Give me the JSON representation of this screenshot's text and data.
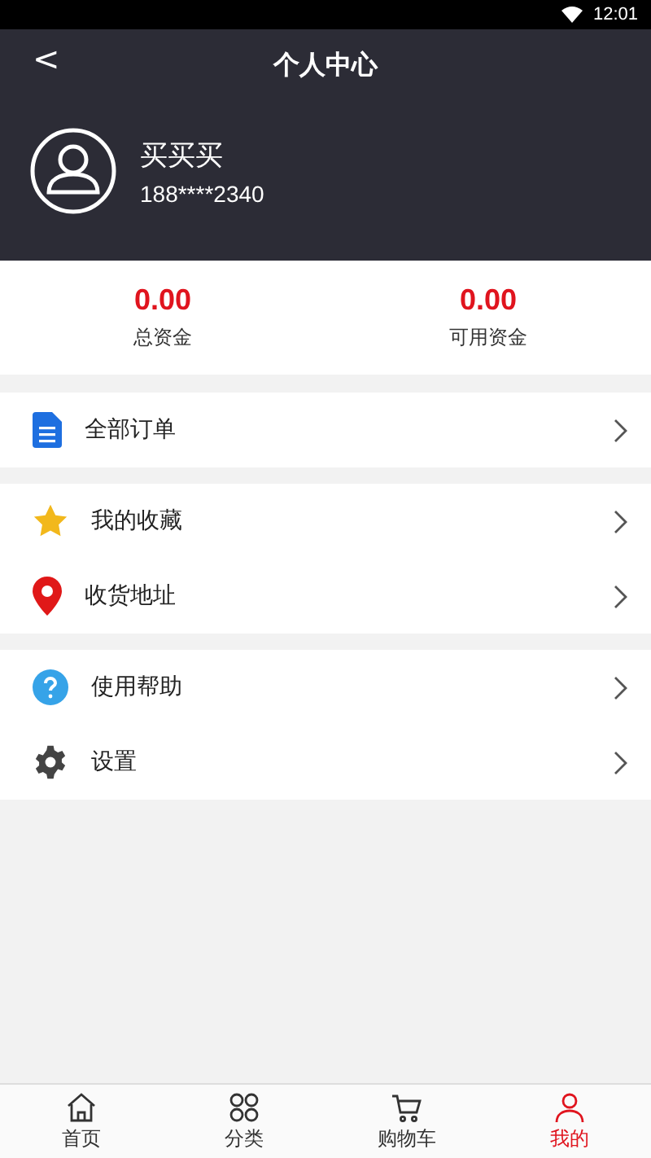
{
  "status_bar": {
    "time": "12:01"
  },
  "header": {
    "back": "<",
    "title": "个人中心"
  },
  "profile": {
    "name": "买买买",
    "phone": "188****2340"
  },
  "balances": [
    {
      "amount": "0.00",
      "label": "总资金"
    },
    {
      "amount": "0.00",
      "label": "可用资金"
    }
  ],
  "menu_groups": [
    [
      {
        "kind": "orders",
        "label": "全部订单"
      }
    ],
    [
      {
        "kind": "favorites",
        "label": "我的收藏"
      },
      {
        "kind": "address",
        "label": "收货地址"
      }
    ],
    [
      {
        "kind": "help",
        "label": "使用帮助"
      },
      {
        "kind": "settings",
        "label": "设置"
      }
    ]
  ],
  "tabs": [
    {
      "kind": "home",
      "label": "首页",
      "selected": false
    },
    {
      "kind": "category",
      "label": "分类",
      "selected": false
    },
    {
      "kind": "cart",
      "label": "购物车",
      "selected": false
    },
    {
      "kind": "me",
      "label": "我的",
      "selected": true
    }
  ]
}
